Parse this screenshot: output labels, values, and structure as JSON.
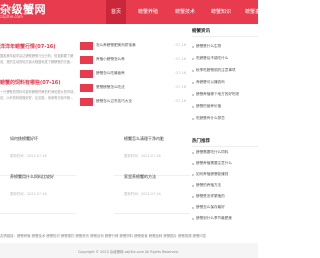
{
  "header": {
    "logo_text": "杂级蟹网",
    "logo_sub": "zajiXie.com",
    "nav": [
      "首页",
      "螃蟹养殖",
      "螃蟹技术",
      "螃蟹知识",
      "螃蟹垂钓"
    ]
  },
  "left_articles": [
    {
      "title": "洋洋年螃蟹行情(07-16)",
      "lines": [
        "国各美年起学杂达螃蟹螃蟹行业分析，知道那要了解",
        "说，是的生动的地方最大程度地发了解螃蟹的方面..."
      ]
    },
    {
      "title": "螃蟹的饲料有哪些(07-16)",
      "lines": [
        "一只螃蟹的饲料可能有螃蟹饲养的时间也很大的市场，",
        "说，以外的特别做好好，比如说，采用等方面不管..."
      ]
    }
  ],
  "thumb_list": [
    {
      "title": "怎么养螃蟹肥美肉质饱满",
      "date": "07-16"
    },
    {
      "title": "养殖小螃蟹怎么养",
      "date": "07-16"
    },
    {
      "title": "螃蟹怎么吃最营养",
      "date": "07-16"
    },
    {
      "title": "蟹蟹螃蟹怎么吃法",
      "date": "07-16"
    },
    {
      "title": "螃蟹怎么过冬技巧大全",
      "date": "07-16"
    }
  ],
  "sidebar": {
    "section1_title": "螃蟹资讯",
    "section1_items": [
      "螃蟹是什么生物",
      "吃螃蟹后不能吃什么",
      "秋季吃螃蟹前的注意事项",
      "养螃蟹可以赚钱吗",
      "螃蟹养殖哪个地方的好吃呢",
      "螃蟹的营养价值",
      "吃螃蟹有什么禁忌"
    ],
    "section2_title": "热门推荐",
    "section2_items": [
      "螃蟹需要吃什么饲料",
      "螃蟹养殖需要注意什么",
      "如何养殖螃蟹能赚钱",
      "螃蟹的养殖方法",
      "螃蟹是怎样繁殖的",
      "螃蟹怎么保存最好",
      "螃蟹到什么季节最肥美"
    ]
  },
  "cards": [
    {
      "title": "如何挑螃蟹好坏",
      "meta": "更新时间：2023-07-16"
    },
    {
      "title": "螃蟹怎么清理干净内脏",
      "meta": "更新时间：2023-07-16"
    },
    {
      "title": "养螃蟹用什么饲料比较好",
      "meta": "更新时间：2023-07-16"
    },
    {
      "title": "家里养螃蟹的方法",
      "meta": "更新时间：2023-07-16"
    }
  ],
  "footer": {
    "row1": "友情链接：螃蟹养殖 螃蟹技术 螃蟹知识 螃蟹垂钓 螃蟹资讯 螃蟹百科 螃蟹行情 螃蟹饲料 螃蟹美食 螃蟹品种 螃蟹图片 螃蟹视频 螃蟹问答",
    "row2": "Copyright © 2023 杂级蟹网 zajiXie.com All Rights Reserved."
  },
  "colors": {
    "brand": "#e83b4e",
    "brand_dark": "#c9283b"
  }
}
